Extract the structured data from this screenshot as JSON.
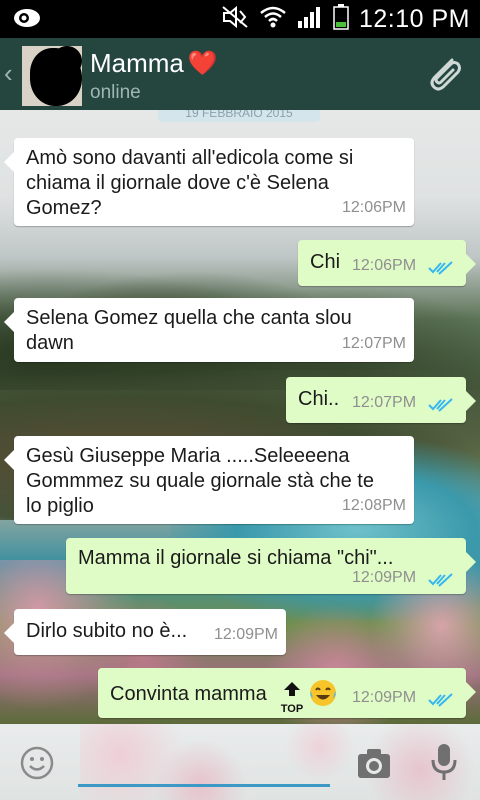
{
  "status_bar": {
    "time": "12:10 PM",
    "icons": [
      "notification-icon",
      "mute-icon",
      "wifi-icon",
      "signal-icon",
      "battery-icon"
    ]
  },
  "header": {
    "contact_name": "Mamma",
    "contact_emoji": "❤️",
    "status": "online",
    "icons": [
      "back-chevron-icon",
      "paperclip-icon"
    ]
  },
  "date_divider": "19 FEBBRAIO 2015",
  "messages": [
    {
      "dir": "in",
      "lines": [
        "Amò sono davanti all'edicola come si",
        "chiama il giornale dove c'è Selena",
        "Gomez?"
      ],
      "time": "12:06PM"
    },
    {
      "dir": "out",
      "lines": [
        "Chi"
      ],
      "time": "12:06PM",
      "read": true
    },
    {
      "dir": "in",
      "lines": [
        "Selena Gomez quella che canta slou",
        "dawn"
      ],
      "time": "12:07PM"
    },
    {
      "dir": "out",
      "lines": [
        "Chi.."
      ],
      "time": "12:07PM",
      "read": true
    },
    {
      "dir": "in",
      "lines": [
        "Gesù Giuseppe Maria .....Seleeeena",
        "Gommmez su quale giornale stà che te",
        "lo piglio"
      ],
      "time": "12:08PM"
    },
    {
      "dir": "out",
      "lines": [
        "Mamma il giornale si chiama \"chi\"..."
      ],
      "time": "12:09PM",
      "read": true
    },
    {
      "dir": "in",
      "lines": [
        "Dirlo subito no è..."
      ],
      "time": "12:09PM"
    },
    {
      "dir": "out",
      "lines": [
        "Convinta mamma"
      ],
      "emojis": [
        "top-arrow-emoji",
        "laughing-tears-emoji"
      ],
      "emoji_label": "TOP",
      "time": "12:09PM",
      "read": true
    }
  ],
  "input_bar": {
    "placeholder": "",
    "icons": [
      "emoji-icon",
      "camera-icon",
      "microphone-icon"
    ]
  },
  "colors": {
    "header": "#24463f",
    "incoming_bubble": "#ffffff",
    "outgoing_bubble": "#e0fcc6",
    "read_ticks": "#34b7f1",
    "input_underline": "#3c98c5"
  }
}
